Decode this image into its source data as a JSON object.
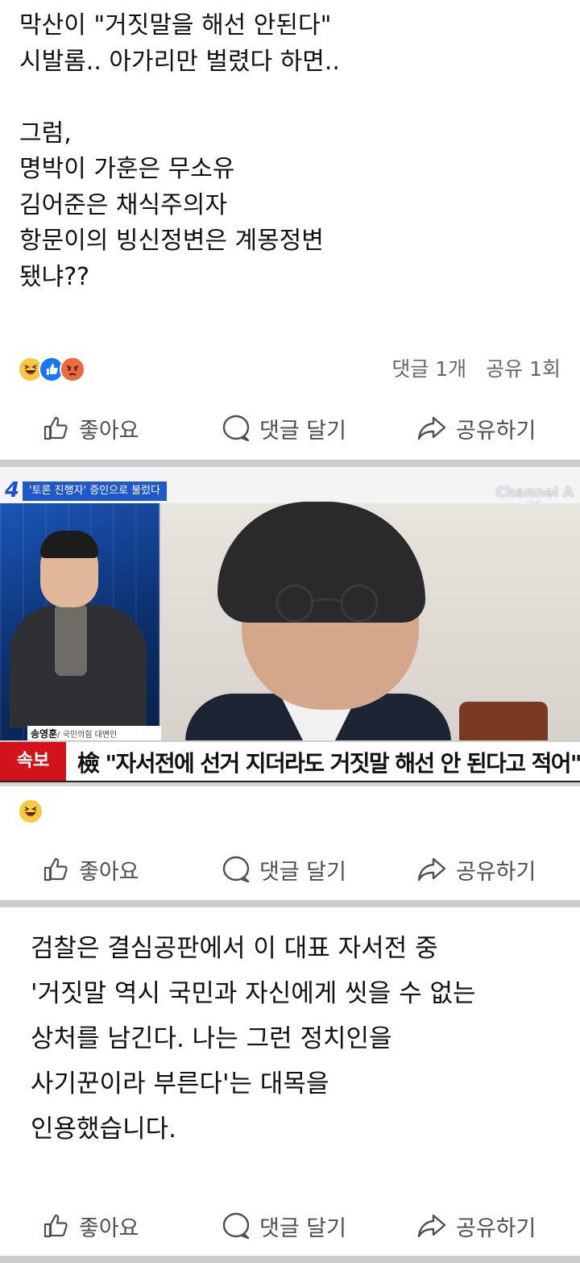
{
  "post1": {
    "text": "막산이 \"거짓말을 해선 안된다\"\n시발롬.. 아가리만 벌렸다 하면..\n\n그럼,\n명박이 가훈은 무소유\n김어준은 채식주의자\n항문이의 빙신정변은 계몽정변\n됐냐??",
    "reactions": [
      "haha-icon",
      "like-icon",
      "angry-icon"
    ],
    "comments": "댓글 1개",
    "shares": "공유 1회"
  },
  "actions": {
    "like": "좋아요",
    "comment": "댓글 달기",
    "share": "공유하기"
  },
  "post2": {
    "news_number": "4",
    "news_tag": "'토론 진행자' 증인으로 불렀다",
    "channel": "Channel A",
    "live": "LIVE",
    "anchor_name": "송영훈",
    "anchor_title": "/ 국민의힘 대변인",
    "breaking_label": "속보",
    "headline": "檢 \"자서전에 선거 지더라도 거짓말 해선 안 된다고 적어\"",
    "reactions": [
      "haha-icon"
    ]
  },
  "post3": {
    "text": "검찰은 결심공판에서 이 대표 자서전 중\n'거짓말 역시 국민과 자신에게 씻을 수 없는\n상처를 남긴다. 나는 그런 정치인을\n사기꾼이라 부른다'는 대목을\n인용했습니다."
  },
  "colors": {
    "like_blue": "#1877f2",
    "haha_yellow": "#f7c843",
    "angry_red": "#e9573f",
    "breaking_red": "#d3131c",
    "divider_gray": "#c9ccd1"
  }
}
